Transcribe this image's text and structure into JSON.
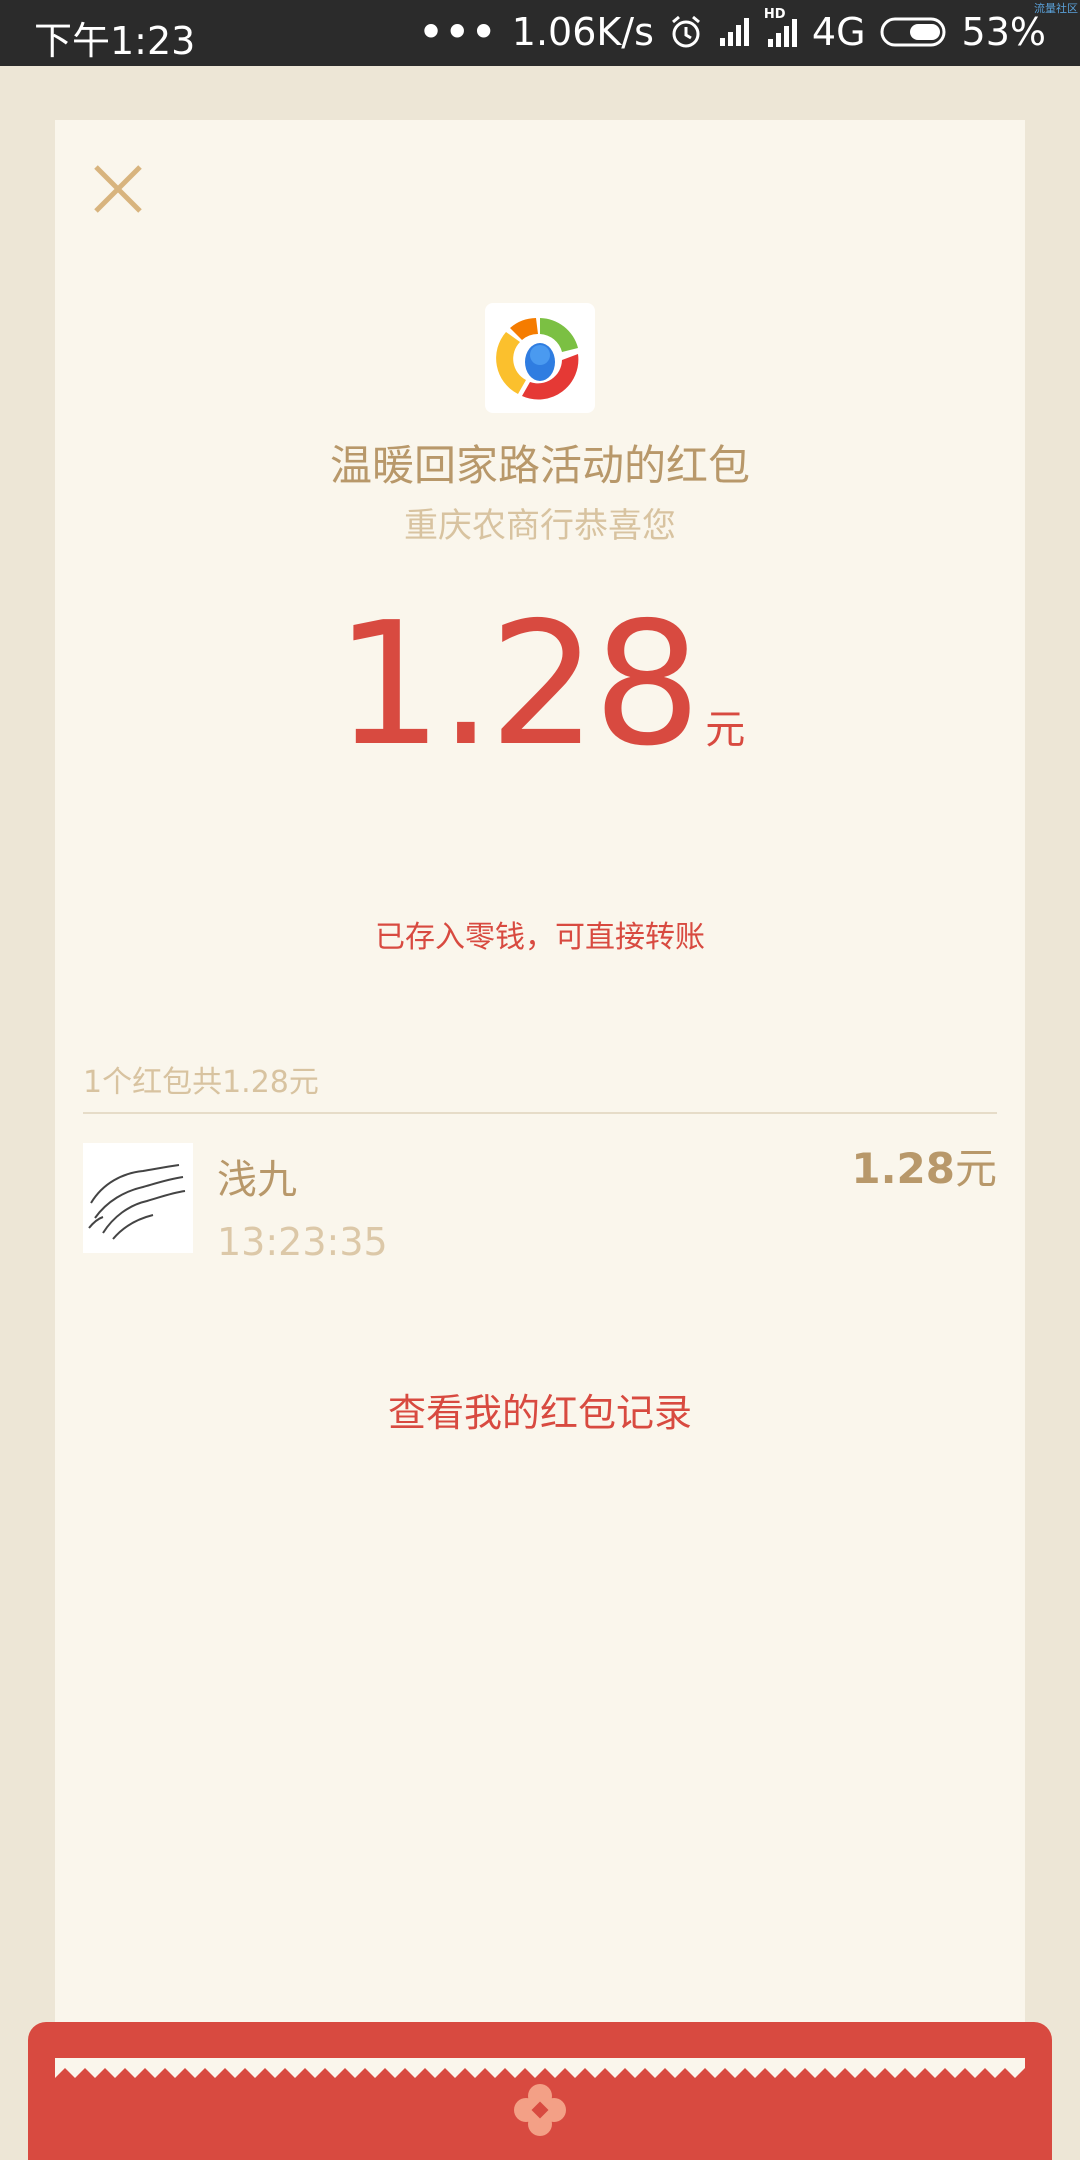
{
  "status_bar": {
    "time": "下午1:23",
    "dots": "•••",
    "speed": "1.06K/s",
    "hd": "HD",
    "network": "4G",
    "battery": "53%",
    "icons": [
      "alarm-icon",
      "signal-icon",
      "signal-hd-icon",
      "battery-icon"
    ],
    "corner_text": "流量社区"
  },
  "card": {
    "close_icon": "close-icon",
    "logo_icon": "qq-news-logo-icon",
    "title": "温暖回家路活动的红包",
    "subtitle": "重庆农商行恭喜您",
    "amount": "1.28",
    "unit": "元",
    "note": "已存入零钱，可直接转账",
    "summary": "1个红包共1.28元",
    "records": [
      {
        "name": "浅九",
        "time": "13:23:35",
        "amount": "1.28",
        "unit": "元",
        "avatar_icon": "hands-sketch-avatar"
      }
    ],
    "view_records_label": "查看我的红包记录"
  },
  "colors": {
    "background": "#ede6d6",
    "card": "#faf6ec",
    "accent_red": "#d84a40",
    "gold": "#b8986a",
    "light_gold": "#d8c3a0"
  }
}
